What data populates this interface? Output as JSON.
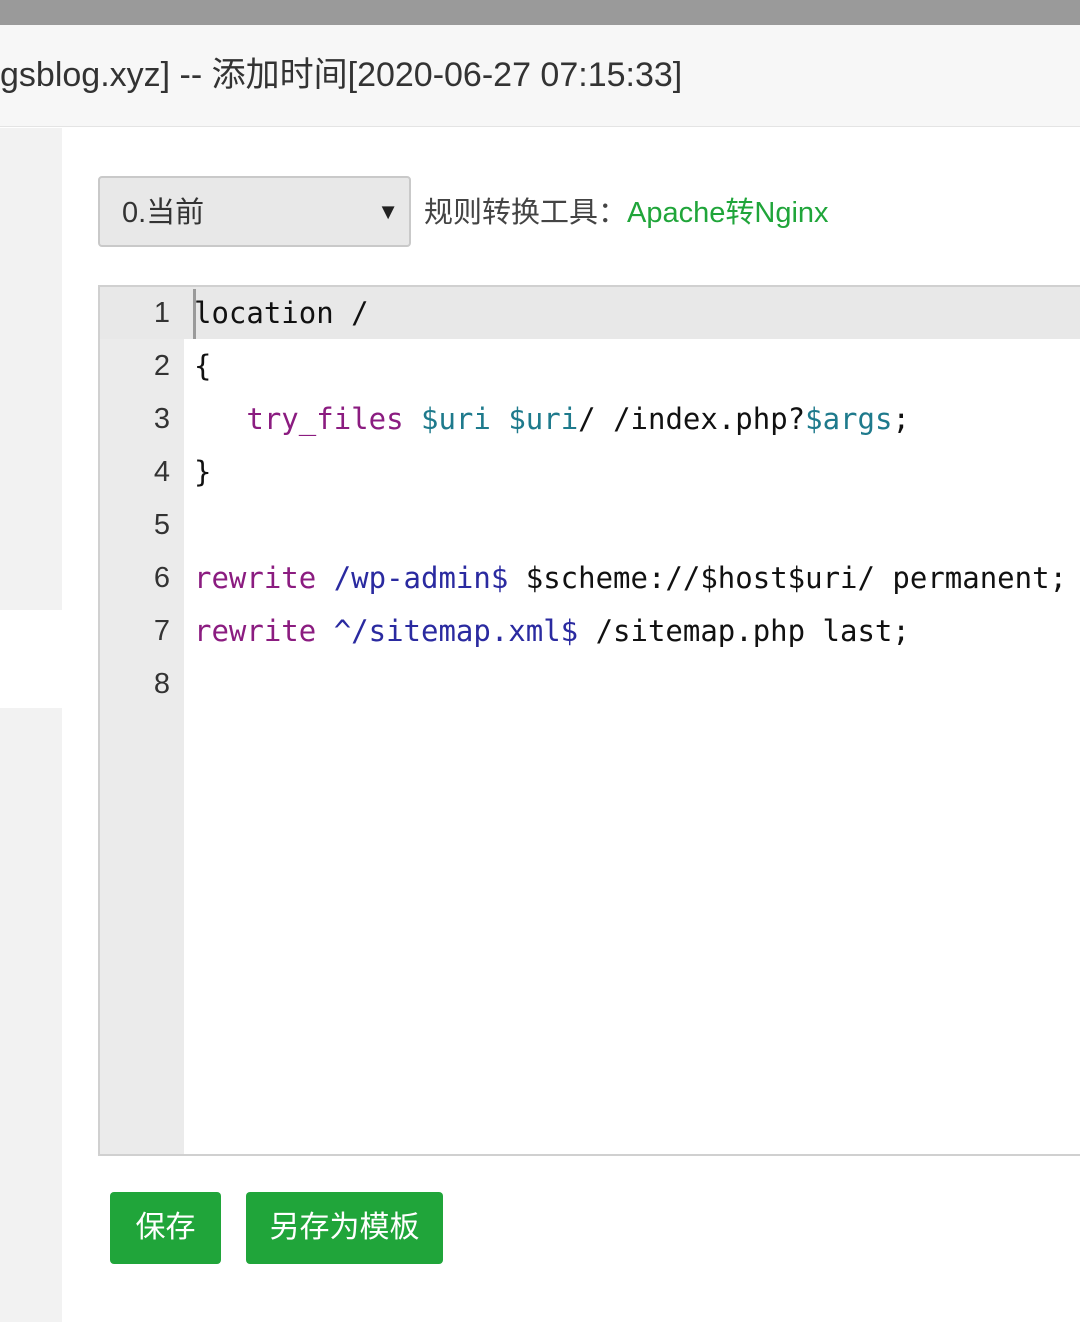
{
  "header": {
    "title": "gsblog.xyz] -- 添加时间[2020-06-27 07:15:33]"
  },
  "version_select": {
    "selected": "0.当前",
    "arrow": "▼"
  },
  "converter": {
    "label": "规则转换工具：",
    "link": "Apache转Nginx",
    "link_color": "#20a53a"
  },
  "editor": {
    "lines": [
      {
        "n": "1",
        "tokens": [
          {
            "t": "location /",
            "c": ""
          }
        ]
      },
      {
        "n": "2",
        "tokens": [
          {
            "t": "{",
            "c": ""
          }
        ]
      },
      {
        "n": "3",
        "tokens": [
          {
            "t": "   ",
            "c": ""
          },
          {
            "t": "try_files",
            "c": "kw"
          },
          {
            "t": " ",
            "c": ""
          },
          {
            "t": "$uri",
            "c": "var"
          },
          {
            "t": " ",
            "c": ""
          },
          {
            "t": "$uri",
            "c": "var"
          },
          {
            "t": "/ /index.php?",
            "c": ""
          },
          {
            "t": "$args",
            "c": "var"
          },
          {
            "t": ";",
            "c": ""
          }
        ]
      },
      {
        "n": "4",
        "tokens": [
          {
            "t": "}",
            "c": ""
          }
        ]
      },
      {
        "n": "5",
        "tokens": [
          {
            "t": "",
            "c": ""
          }
        ]
      },
      {
        "n": "6",
        "tokens": [
          {
            "t": "rewrite",
            "c": "kw"
          },
          {
            "t": " ",
            "c": ""
          },
          {
            "t": "/wp-admin$",
            "c": "re"
          },
          {
            "t": " $scheme://$host$uri/ permanent;",
            "c": ""
          }
        ]
      },
      {
        "n": "7",
        "tokens": [
          {
            "t": "rewrite",
            "c": "kw"
          },
          {
            "t": " ",
            "c": ""
          },
          {
            "t": "^/sitemap.xml$",
            "c": "re"
          },
          {
            "t": " /sitemap.php last;",
            "c": ""
          }
        ]
      },
      {
        "n": "8",
        "tokens": [
          {
            "t": "",
            "c": ""
          }
        ]
      }
    ]
  },
  "buttons": {
    "save": "保存",
    "save_as_template": "另存为模板",
    "color": "#20a53a"
  }
}
